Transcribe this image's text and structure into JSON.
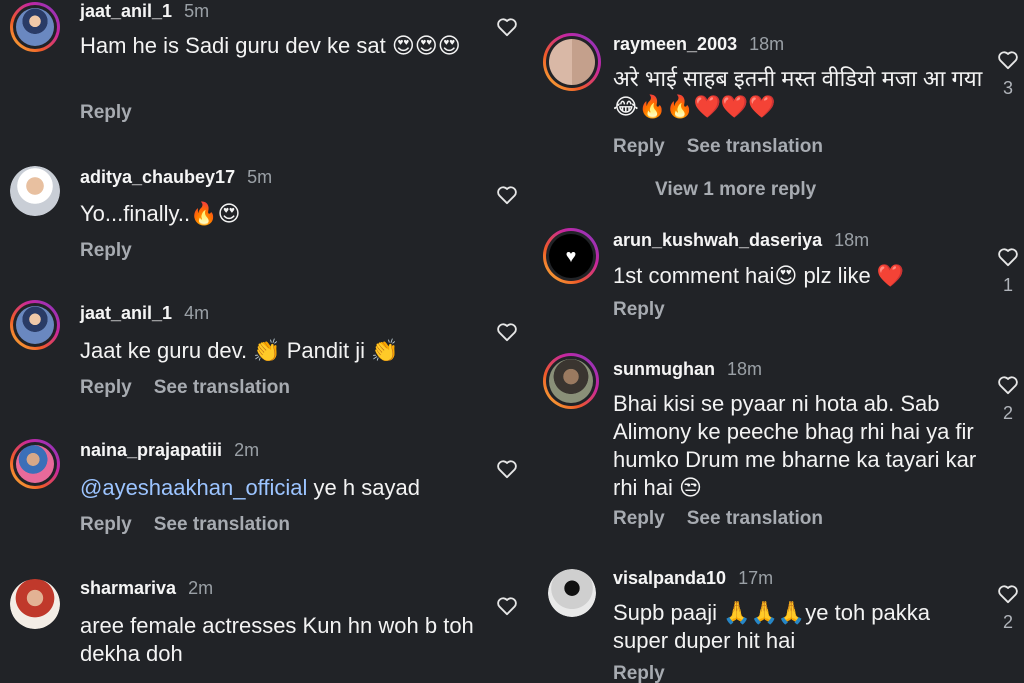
{
  "left_comments": [
    {
      "username": "jaat_anil_1",
      "time": "5m",
      "text": "Ham he is Sadi guru dev ke sat 😍😍😍",
      "actions": [
        "Reply"
      ]
    },
    {
      "username": "aditya_chaubey17",
      "time": "5m",
      "text": "Yo...finally..🔥😍",
      "actions": [
        "Reply"
      ]
    },
    {
      "username": "jaat_anil_1",
      "time": "4m",
      "text": "Jaat ke guru dev. 👏 Pandit ji 👏",
      "actions": [
        "Reply",
        "See translation"
      ]
    },
    {
      "username": "naina_prajapatiii",
      "time": "2m",
      "mention": "@ayeshaakhan_official",
      "text": " ye h sayad",
      "actions": [
        "Reply",
        "See translation"
      ]
    },
    {
      "username": "sharmariva",
      "time": "2m",
      "text": "aree female actresses Kun hn woh b toh dekha doh",
      "actions": []
    }
  ],
  "right_comments": [
    {
      "username": "raymeen_2003",
      "time": "18m",
      "text": "अरे भाई साहब इतनी मस्त वीडियो मजा आ गया😂🔥🔥❤️❤️❤️",
      "actions": [
        "Reply",
        "See translation"
      ],
      "likes": "3",
      "view_more": "View 1 more reply"
    },
    {
      "username": "arun_kushwah_daseriya",
      "time": "18m",
      "text": "1st comment  hai😍 plz like ❤️",
      "actions": [
        "Reply"
      ],
      "likes": "1"
    },
    {
      "username": "sunmughan",
      "time": "18m",
      "text": "Bhai kisi se pyaar ni hota ab. Sab Alimony ke peeche bhag rhi hai ya fir humko Drum me bharne ka tayari kar rhi hai 😒",
      "actions": [
        "Reply",
        "See translation"
      ],
      "likes": "2"
    },
    {
      "username": "visalpanda10",
      "time": "17m",
      "text": "Supb paaji 🙏🙏🙏ye toh pakka super duper hit hai",
      "actions": [
        "Reply"
      ],
      "likes": "2"
    }
  ]
}
